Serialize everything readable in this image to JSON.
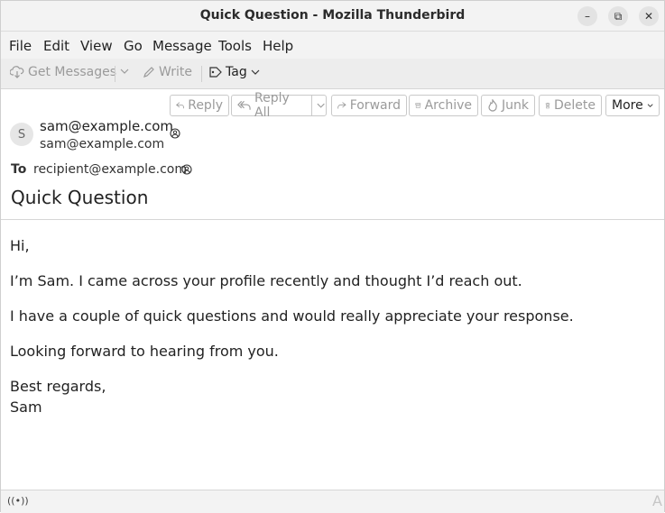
{
  "window": {
    "title": "Quick Question - Mozilla Thunderbird",
    "controls": {
      "minimize": "–",
      "maximize": "⧉",
      "close": "✕"
    }
  },
  "menubar": {
    "items": [
      "File",
      "Edit",
      "View",
      "Go",
      "Message",
      "Tools",
      "Help"
    ]
  },
  "toolbar": {
    "get_messages": "Get Messages",
    "write": "Write",
    "tag": "Tag"
  },
  "header_actions": {
    "reply": "Reply",
    "reply_all": "Reply All",
    "forward": "Forward",
    "archive": "Archive",
    "junk": "Junk",
    "delete": "Delete",
    "more": "More"
  },
  "message": {
    "avatar_initial": "S",
    "from_name": "sam@example.com",
    "from_address": "sam@example.com",
    "to_label": "To",
    "to_address": "recipient@example.com",
    "subject": "Quick Question",
    "body": [
      "Hi,",
      "I’m Sam. I came across your profile recently and thought I’d reach out.",
      "I have a couple of quick questions and would really appreciate your response.",
      "Looking forward to hearing from you.",
      "Best regards,",
      "Sam"
    ]
  },
  "statusbar": {
    "activity_icon": "((•))",
    "resize_glyph": "A"
  },
  "colors": {
    "titlebar_bg": "#f3f3f3",
    "toolbar_bg": "#ededed",
    "disabled_text": "#9a9a9a"
  }
}
